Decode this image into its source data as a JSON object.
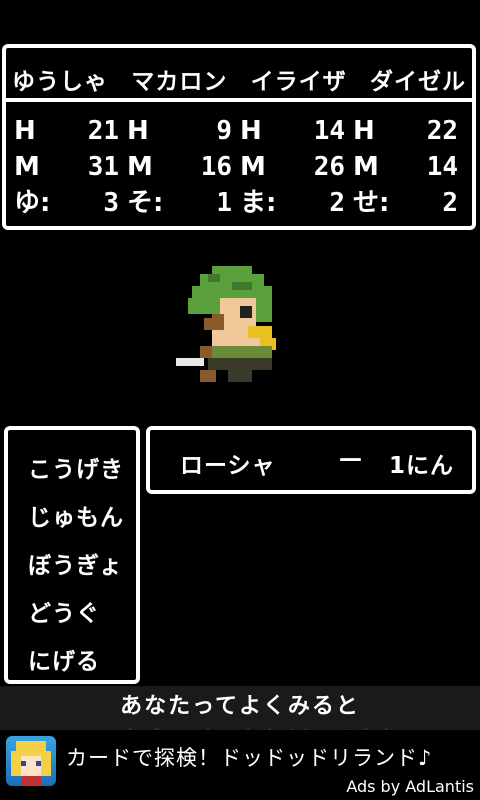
{
  "party": {
    "names": [
      "ゆうしゃ",
      "マカロン",
      "イライザ",
      "ダイゼル"
    ],
    "rows": [
      [
        [
          "H",
          "21"
        ],
        [
          "H",
          "9"
        ],
        [
          "H",
          "14"
        ],
        [
          "H",
          "22"
        ]
      ],
      [
        [
          "M",
          "31"
        ],
        [
          "M",
          "16"
        ],
        [
          "M",
          "26"
        ],
        [
          "M",
          "14"
        ]
      ],
      [
        [
          "ゆ:",
          "3"
        ],
        [
          "そ:",
          "1"
        ],
        [
          "ま:",
          "2"
        ],
        [
          "せ:",
          "2"
        ]
      ]
    ]
  },
  "commands": [
    "こうげき",
    "じゅもん",
    "ぼうぎょ",
    "どうぐ",
    "にげる"
  ],
  "enemy": {
    "name": "ローシャ",
    "dash": "—",
    "count": "1にん"
  },
  "message": {
    "line1": "あなたってよくみると",
    "line2": "ドワネズミみたいなカオしてるわね"
  },
  "ad": {
    "icon": "character-face-icon",
    "text": "カードで探検！ドッドッドリランド♪",
    "by": "Ads by AdLantis"
  },
  "colors": {
    "background": "#000000",
    "frame": "#ffffff",
    "hair": "#5aa03c",
    "skin": "#f0c89a",
    "scarf": "#e8c020"
  }
}
